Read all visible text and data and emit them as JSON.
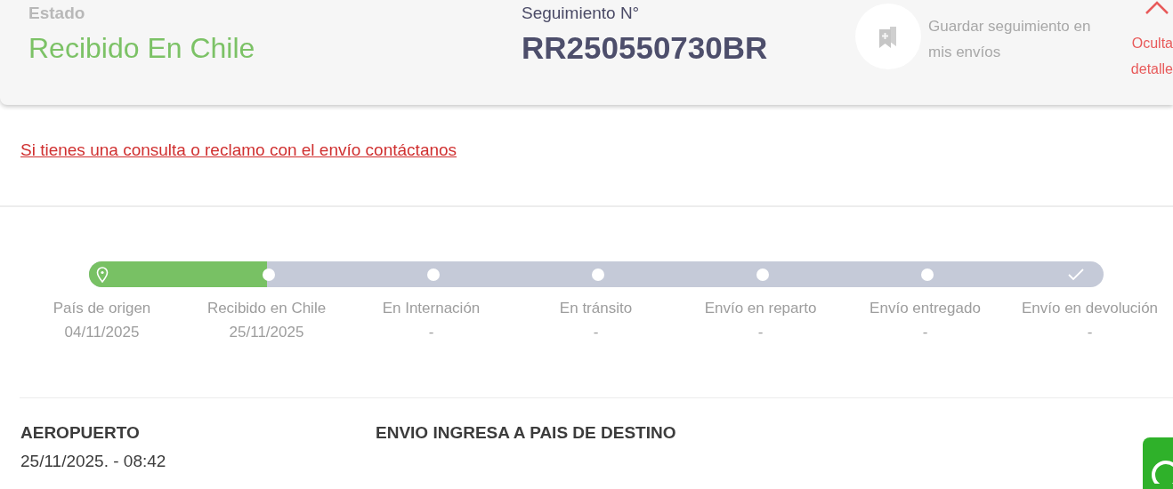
{
  "header": {
    "status_label": "Estado",
    "status": "Recibido En Chile",
    "tracking_label": "Seguimiento N°",
    "tracking_number": "RR250550730BR",
    "save_text": "Guardar seguimiento en mis envíos",
    "hide_lines": [
      "Oculta",
      "detalle"
    ]
  },
  "contact_link": "Si tienes una consulta o reclamo con el envío contáctanos",
  "progress": {
    "level": 0.175
  },
  "steps": [
    {
      "kind": "origin",
      "label": "País de origen",
      "date": "04/11/2025"
    },
    {
      "kind": "dot",
      "label": "Recibido en Chile",
      "date": "25/11/2025"
    },
    {
      "kind": "dot",
      "label": "En Internación",
      "date": "-"
    },
    {
      "kind": "dot",
      "label": "En tránsito",
      "date": "-"
    },
    {
      "kind": "dot",
      "label": "Envío en reparto",
      "date": "-"
    },
    {
      "kind": "dot",
      "label": "Envío entregado",
      "date": "-"
    },
    {
      "kind": "final",
      "label": "Envío en devolución",
      "date": "-"
    }
  ],
  "event": {
    "place": "AEROPUERTO",
    "datetime": "25/11/2025. - 08:42",
    "description": "ENVIO INGRESA A PAIS DE DESTINO"
  }
}
